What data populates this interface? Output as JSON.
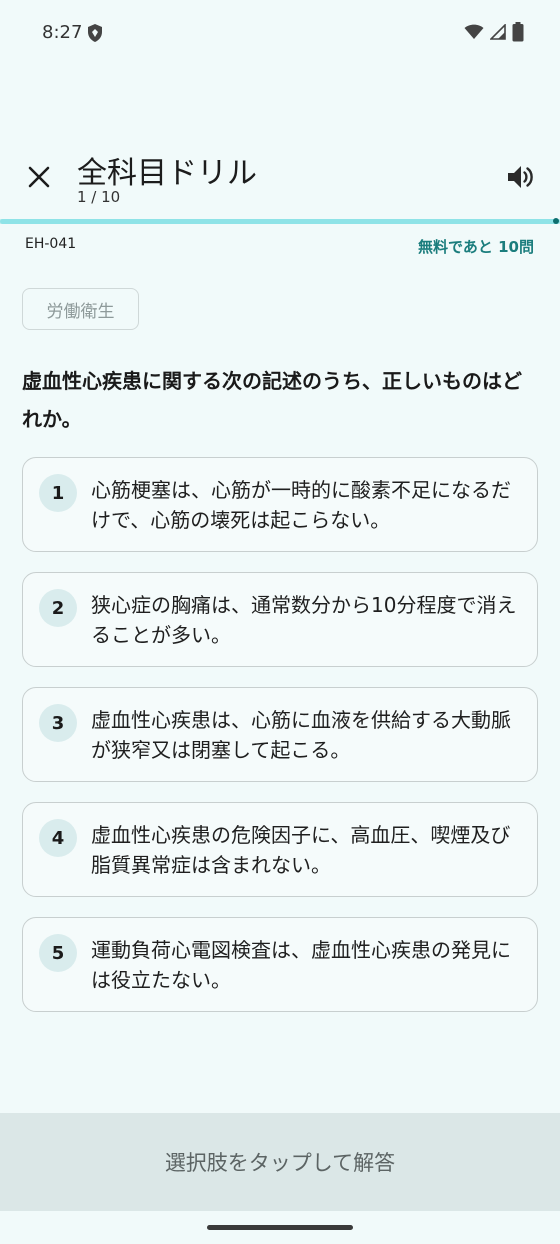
{
  "status_bar": {
    "time": "8:27",
    "icons": [
      "shield-icon",
      "wifi-icon",
      "signal-icon",
      "battery-icon"
    ]
  },
  "header": {
    "title": "全科目ドリル",
    "counter": "1 / 10",
    "close_icon": "close-icon",
    "sound_icon": "volume-icon"
  },
  "progress": {
    "fraction": 1.0
  },
  "meta": {
    "question_id": "EH-041",
    "free_remaining": "無料であと 10問"
  },
  "category": "労働衛生",
  "question": "虚血性心疾患に関する次の記述のうち、正しいものはどれか。",
  "options": [
    {
      "number": "1",
      "text": "心筋梗塞は、心筋が一時的に酸素不足になるだけで、心筋の壊死は起こらない。"
    },
    {
      "number": "2",
      "text": "狭心症の胸痛は、通常数分から10分程度で消えることが多い。"
    },
    {
      "number": "3",
      "text": "虚血性心疾患は、心筋に血液を供給する大動脈が狭窄又は閉塞して起こる。"
    },
    {
      "number": "4",
      "text": "虚血性心疾患の危険因子に、高血圧、喫煙及び脂質異常症は含まれない。"
    },
    {
      "number": "5",
      "text": "運動負荷心電図検査は、虚血性心疾患の発見には役立たない。"
    }
  ],
  "answer_button": "選択肢をタップして解答",
  "colors": {
    "background": "#f1fafa",
    "accent": "#1b7d7d",
    "progress": "#8fe3e7"
  }
}
